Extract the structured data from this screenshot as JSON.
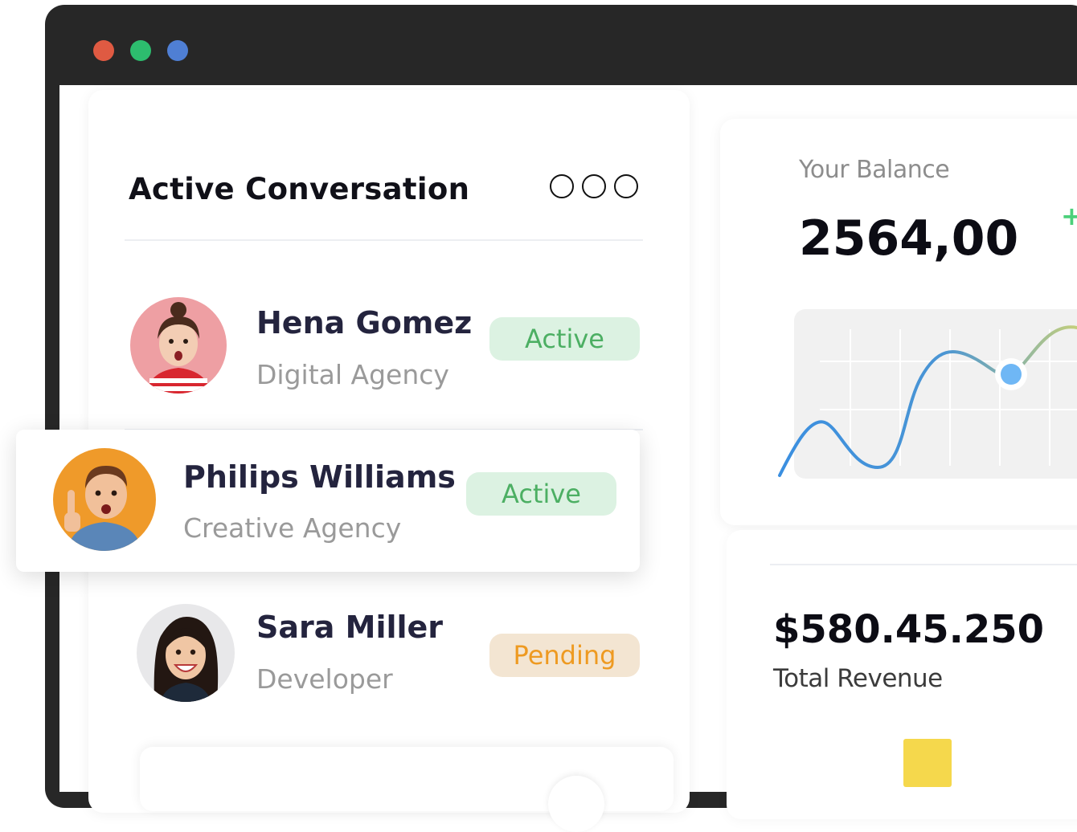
{
  "conversation": {
    "title": "Active Conversation",
    "contacts": [
      {
        "name": "Hena Gomez",
        "role": "Digital Agency",
        "status": "Active"
      },
      {
        "name": "Philips Williams",
        "role": "Creative Agency",
        "status": "Active"
      },
      {
        "name": "Sara Miller",
        "role": "Developer",
        "status": "Pending"
      }
    ]
  },
  "balance": {
    "label": "Your Balance",
    "value": "2564,00",
    "change_sign": "+"
  },
  "revenue": {
    "value": "$580.45.250",
    "label": "Total Revenue"
  },
  "colors": {
    "window_frame": "#272727",
    "dot_red": "#df5a42",
    "dot_green": "#2dbd6e",
    "dot_blue": "#4f7fd4",
    "active_bg": "#dcf2e2",
    "active_text": "#4caf63",
    "pending_bg": "#f3e5d2",
    "pending_text": "#ee9a21"
  }
}
